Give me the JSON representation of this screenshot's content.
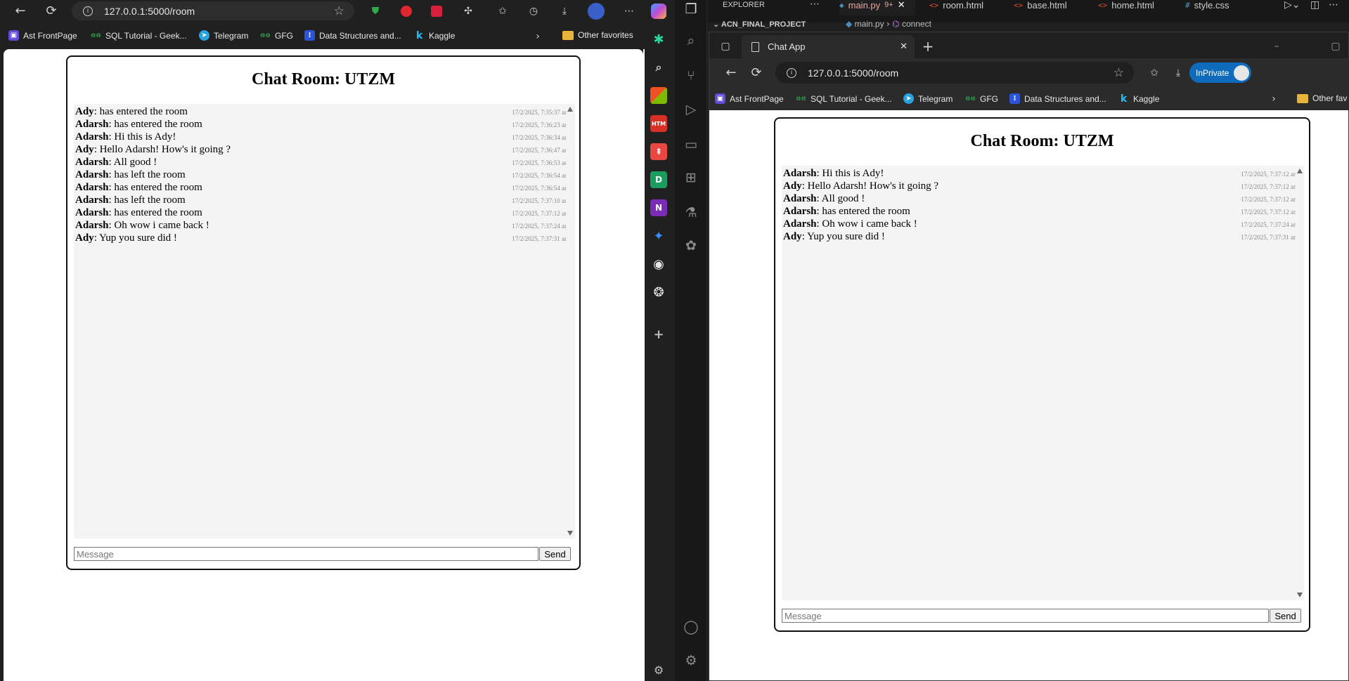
{
  "left_browser": {
    "address": "127.0.0.1:5000/room",
    "bookmarks": [
      "Ast FrontPage",
      "SQL Tutorial - Geek...",
      "Telegram",
      "GFG",
      "Data Structures and...",
      "Kaggle"
    ],
    "other_favorites": "Other favorites"
  },
  "vscode": {
    "explorer_label": "EXPLORER",
    "project_name": "ACN_FINAL_PROJECT",
    "tabs": [
      "main.py",
      "room.html",
      "base.html",
      "home.html",
      "style.css"
    ],
    "main_tab_badge": "9+",
    "breadcrumb": [
      "main.py",
      "connect"
    ]
  },
  "right_browser": {
    "tab_title": "Chat App",
    "address": "127.0.0.1:5000/room",
    "inprivate_label": "InPrivate",
    "bookmarks": [
      "Ast FrontPage",
      "SQL Tutorial - Geek...",
      "Telegram",
      "GFG",
      "Data Structures and...",
      "Kaggle"
    ],
    "other_favorites": "Other fav"
  },
  "chat_left": {
    "title": "Chat Room: UTZM",
    "placeholder": "Message",
    "send_label": "Send",
    "messages": [
      {
        "name": "Ady",
        "text": ": has entered the room",
        "time": "17/2/2025, 7:35:37 am"
      },
      {
        "name": "Adarsh",
        "text": ": has entered the room",
        "time": "17/2/2025, 7:36:23 am"
      },
      {
        "name": "Adarsh",
        "text": ": Hi this is Ady!",
        "time": "17/2/2025, 7:36:34 am"
      },
      {
        "name": "Ady",
        "text": ": Hello Adarsh! How's it going ?",
        "time": "17/2/2025, 7:36:47 am"
      },
      {
        "name": "Adarsh",
        "text": ": All good !",
        "time": "17/2/2025, 7:36:53 am"
      },
      {
        "name": "Adarsh",
        "text": ": has left the room",
        "time": "17/2/2025, 7:36:54 am"
      },
      {
        "name": "Adarsh",
        "text": ": has entered the room",
        "time": "17/2/2025, 7:36:54 am"
      },
      {
        "name": "Adarsh",
        "text": ": has left the room",
        "time": "17/2/2025, 7:37:10 am"
      },
      {
        "name": "Adarsh",
        "text": ": has entered the room",
        "time": "17/2/2025, 7:37:12 am"
      },
      {
        "name": "Adarsh",
        "text": ": Oh wow i came back !",
        "time": "17/2/2025, 7:37:24 am"
      },
      {
        "name": "Ady",
        "text": ": Yup you sure did !",
        "time": "17/2/2025, 7:37:31 am"
      }
    ]
  },
  "chat_right": {
    "title": "Chat Room: UTZM",
    "placeholder": "Message",
    "send_label": "Send",
    "messages": [
      {
        "name": "Adarsh",
        "text": ": Hi this is Ady!",
        "time": "17/2/2025, 7:37:12 am"
      },
      {
        "name": "Ady",
        "text": ": Hello Adarsh! How's it going ?",
        "time": "17/2/2025, 7:37:12 am"
      },
      {
        "name": "Adarsh",
        "text": ": All good !",
        "time": "17/2/2025, 7:37:12 am"
      },
      {
        "name": "Adarsh",
        "text": ": has entered the room",
        "time": "17/2/2025, 7:37:12 am"
      },
      {
        "name": "Adarsh",
        "text": ": Oh wow i came back !",
        "time": "17/2/2025, 7:37:24 am"
      },
      {
        "name": "Ady",
        "text": ": Yup you sure did !",
        "time": "17/2/2025, 7:37:31 am"
      }
    ]
  },
  "colors": {
    "chrome_bg": "#1f1f1f",
    "tab_active": "#2b2b2b",
    "inprivate": "#0f6cbd",
    "chat_area": "#f4f4f4"
  }
}
